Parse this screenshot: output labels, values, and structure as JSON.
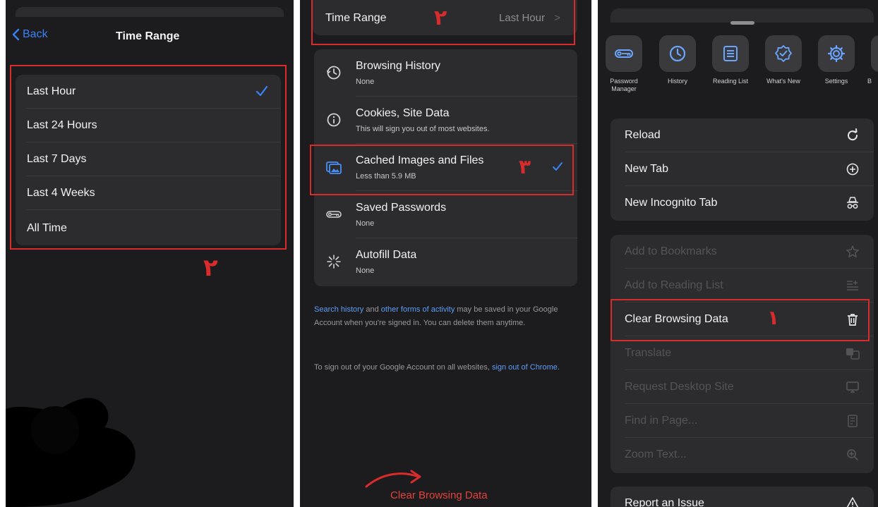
{
  "panel_time_range": {
    "back_label": "Back",
    "title": "Time Range",
    "options": [
      {
        "label": "Last Hour",
        "selected": true
      },
      {
        "label": "Last 24 Hours",
        "selected": false
      },
      {
        "label": "Last 7 Days",
        "selected": false
      },
      {
        "label": "Last 4 Weeks",
        "selected": false
      },
      {
        "label": "All Time",
        "selected": false
      }
    ],
    "annotation": "٢"
  },
  "panel_clear_data": {
    "time_range_label": "Time Range",
    "time_range_value": "Last Hour",
    "time_range_chevron": ">",
    "time_range_annotation": "٢",
    "items": [
      {
        "title": "Browsing History",
        "subtitle": "None",
        "icon": "history-icon"
      },
      {
        "title": "Cookies, Site Data",
        "subtitle": "This will sign you out of most websites.",
        "icon": "info-icon"
      },
      {
        "title": "Cached Images and Files",
        "subtitle": "Less than 5.9 MB",
        "icon": "images-icon",
        "checked": true
      },
      {
        "title": "Saved Passwords",
        "subtitle": "None",
        "icon": "key-icon"
      },
      {
        "title": "Autofill Data",
        "subtitle": "None",
        "icon": "sparkle-icon"
      }
    ],
    "cached_annotation": "٣",
    "footer1": {
      "link1": "Search history",
      "text1": " and ",
      "link2": "other forms of activity",
      "text2": " may be saved in your Google Account when you're signed in. You can delete them anytime."
    },
    "footer2": {
      "text1": "To sign out of your Google Account on all websites, ",
      "link1": "sign out of Chrome",
      "text2": "."
    },
    "clear_button": "Clear Browsing Data"
  },
  "panel_menu": {
    "quick_actions": [
      {
        "label": "Password Manager",
        "icon": "key-icon"
      },
      {
        "label": "History",
        "icon": "history-icon"
      },
      {
        "label": "Reading List",
        "icon": "reading-list-icon"
      },
      {
        "label": "What's New",
        "icon": "badge-check-icon"
      },
      {
        "label": "Settings",
        "icon": "gear-icon"
      },
      {
        "label": "B",
        "icon": "bookmarks-icon"
      }
    ],
    "group1": [
      "Reload",
      "New Tab",
      "New Incognito Tab"
    ],
    "group2": [
      {
        "label": "Add to Bookmarks",
        "enabled": false
      },
      {
        "label": "Add to Reading List",
        "enabled": false
      },
      {
        "label": "Clear Browsing Data",
        "enabled": true
      },
      {
        "label": "Translate",
        "enabled": false
      },
      {
        "label": "Request Desktop Site",
        "enabled": false
      },
      {
        "label": "Find in Page...",
        "enabled": false
      },
      {
        "label": "Zoom Text...",
        "enabled": false
      }
    ],
    "clear_annotation": "١",
    "report_issue": "Report an Issue"
  },
  "colors": {
    "background": "#1c1c1e",
    "cell": "#2c2c2e",
    "accent_blue": "#3a82f6",
    "annotation_red": "#d92b2b",
    "destructive_red": "#e5413c"
  }
}
